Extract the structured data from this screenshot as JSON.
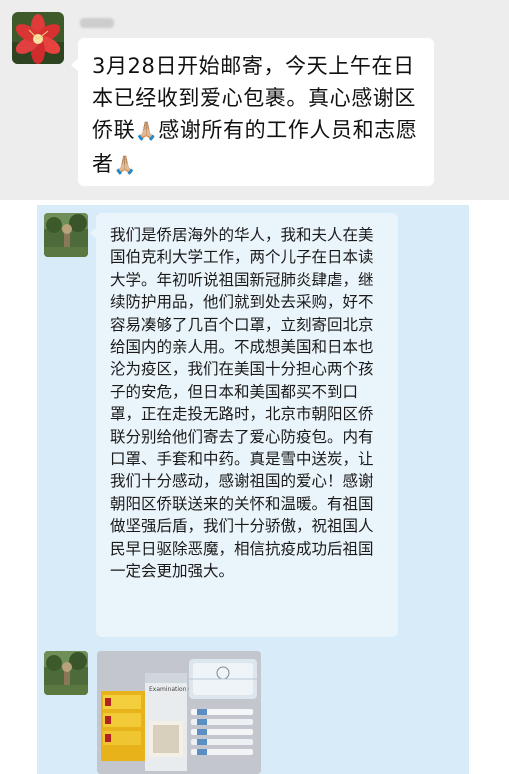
{
  "top_chat": {
    "sender": "",
    "message": "3月28日开始邮寄，今天上午在日本已经收到爱心包裹。真心感谢区侨联",
    "message_b": "感谢所有的工作人员和志愿者",
    "emoji": "🙏🏼"
  },
  "screenshot_chat": {
    "message": "我们是侨居海外的华人，我和夫人在美国伯克利大学工作，两个儿子在日本读大学。年初听说祖国新冠肺炎肆虐，继续防护用品，他们就到处去采购，好不容易凑够了几百个口罩，立刻寄回北京给国内的亲人用。不成想美国和日本也沦为疫区，我们在美国十分担心两个孩子的安危，但日本和美国都买不到口罩，正在走投无路时，北京市朝阳区侨联分别给他们寄去了爱心防疫包。内有口罩、手套和中药。真是雪中送炭，让我们十分感动，感谢祖国的爱心！感谢朝阳区侨联送来的关怀和温暖。有祖国做坚强后盾，我们十分骄傲，祝祖国人民早日驱除恶魔，相信抗疫成功后祖国一定会更加强大。"
  },
  "photo": {
    "glove_box_label": "Examination Gloves"
  },
  "colors": {
    "top_bg": "#ededed",
    "screenshot_bg": "#d7ebf8",
    "bubble_light": "#eaf4fb"
  }
}
